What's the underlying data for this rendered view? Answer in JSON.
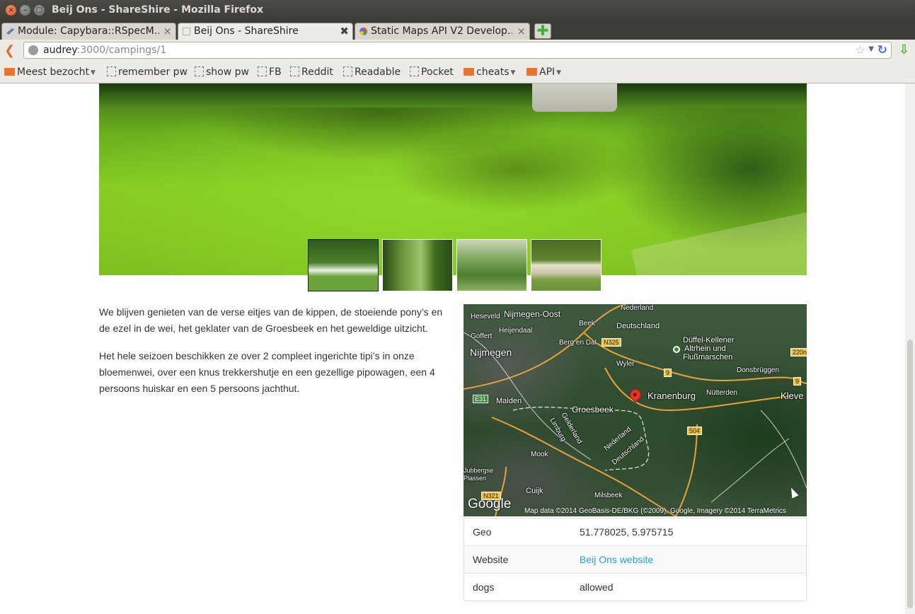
{
  "window": {
    "title": "Beij Ons - ShareShire - Mozilla Firefox"
  },
  "tabs": [
    {
      "label": "Module: Capybara::RSpecM…",
      "icon": "capybara-icon"
    },
    {
      "label": "Beij Ons - ShareShire",
      "icon": "blank-page-icon",
      "active": true
    },
    {
      "label": "Static Maps API V2 Develop…",
      "icon": "google-icon"
    }
  ],
  "navbar": {
    "url_host": "audrey",
    "url_rest": ":3000/campings/1"
  },
  "bookmarks": {
    "most_visited": "Meest bezocht",
    "items": [
      "remember pw",
      "show pw",
      "FB",
      "Reddit",
      "Readable",
      "Pocket"
    ],
    "folders": [
      "cheats",
      "API"
    ]
  },
  "content": {
    "description": [
      "We blijven genieten van de verse eitjes van de kippen, de stoeiende pony’s en de ezel in de wei, het geklater van de Groesbeek en het geweldige uitzicht.",
      "Het hele seizoen beschikken ze over 2 compleet ingerichte tipi’s in onze bloemenwei, over een knus trekkershutje en een gezellige pipowagen, een 4 persoons huiskar en een 5 persoons jachthut."
    ],
    "map": {
      "labels": {
        "heseveld": "Heseveld",
        "nijmegen_oost": "Nijmegen-Oost",
        "nederland_top": "Nederland",
        "heijendaal": "Heijendaal",
        "beek": "Beek",
        "deutschland_top": "Deutschland",
        "goffert": "Goffert",
        "berg_en_dal": "Berg en Dal",
        "duffel": "Düffel-Kellener",
        "altrhein": "Altrhein und",
        "flussmarschen": "Flußmarschen",
        "nijmegen": "Nijmegen",
        "wyler": "Wyler",
        "donsbruggen": "Donsbrüggen",
        "kranenburg": "Kranenburg",
        "nutterden": "Nütterden",
        "kleve": "Kleve",
        "malden": "Malden",
        "groesbeek": "Groesbeek",
        "gelderland": "Gelderland",
        "limburg": "Limburg",
        "nederland_mid": "Nederland",
        "deutschland_mid": "Deutschland",
        "mook": "Mook",
        "jubbergse": "Jubbergse",
        "plassen": "Plassen",
        "cuijk": "Cuijk",
        "milsbeek": "Milsbeek"
      },
      "shields": {
        "n325": "N325",
        "r9a": "9",
        "r9b": "9",
        "r504": "504",
        "e31": "E31",
        "n321": "N321",
        "r220": "220n"
      },
      "google": "Google",
      "attribution": "Map data ©2014 GeoBasis-DE/BKG (©2009), Google, Imagery ©2014 TerraMetrics"
    },
    "info": [
      {
        "key": "Geo",
        "value": "51.778025, 5.975715"
      },
      {
        "key": "Website",
        "value": "Beij Ons website",
        "link": true
      },
      {
        "key": "dogs",
        "value": "allowed"
      }
    ]
  },
  "colors": {
    "link": "#2a9fd6",
    "text": "#333333"
  }
}
